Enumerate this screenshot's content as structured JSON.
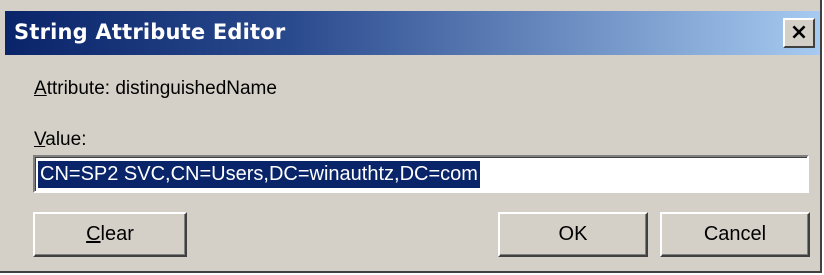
{
  "window": {
    "title": "String Attribute Editor",
    "close_glyph": "×"
  },
  "attribute": {
    "prefix_underlined": "A",
    "prefix_rest": "ttribute:",
    "name": "distinguishedName"
  },
  "value": {
    "label_underlined": "V",
    "label_rest": "alue:",
    "text": "CN=SP2 SVC,CN=Users,DC=winauthtz,DC=com",
    "selected": true
  },
  "buttons": {
    "clear_underlined": "C",
    "clear_rest": "lear",
    "ok": "OK",
    "cancel": "Cancel"
  },
  "colors": {
    "title_start": "#0a246a",
    "title_end": "#a6caf0",
    "face": "#d4d0c8",
    "selection": "#0a246a"
  }
}
